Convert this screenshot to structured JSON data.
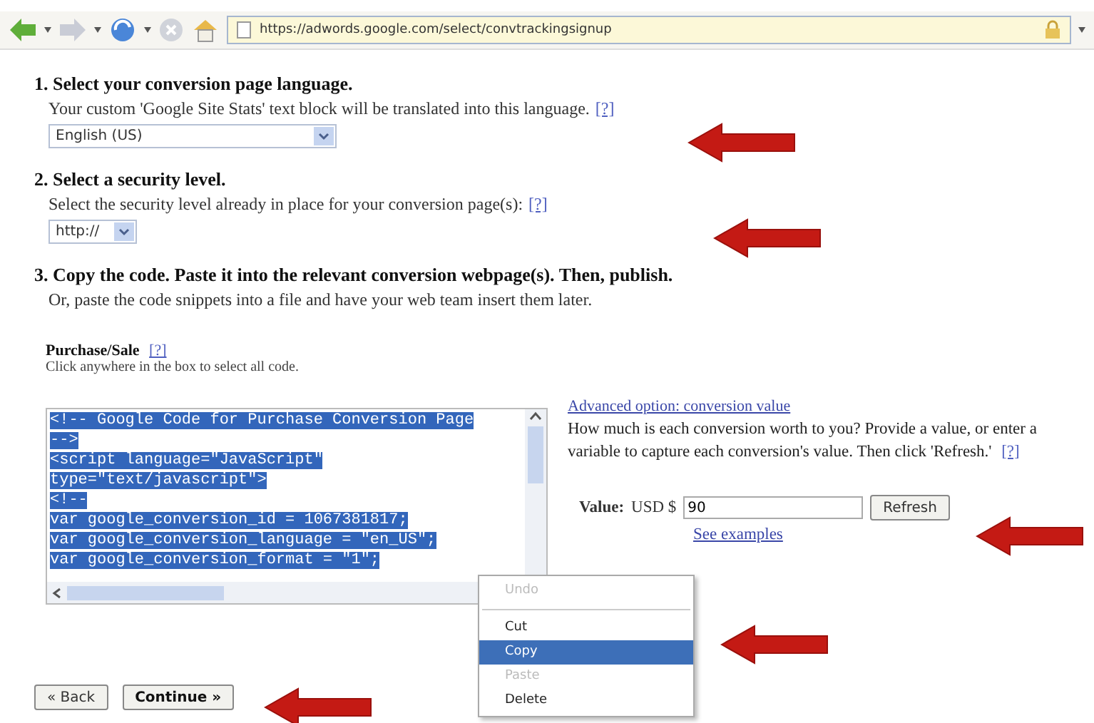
{
  "browser": {
    "url": "https://adwords.google.com/select/convtrackingsignup"
  },
  "steps": [
    {
      "number": "1.",
      "title": "Select your conversion page language.",
      "description": "Your custom 'Google Site Stats' text block will be translated into this language.",
      "help": "[?]",
      "select": {
        "value": "English (US)",
        "wide": true
      }
    },
    {
      "number": "2.",
      "title": "Select a security level.",
      "description": "Select the security level already in place for your conversion page(s):",
      "help": "[?]",
      "select": {
        "value": "http://",
        "wide": false
      }
    },
    {
      "number": "3.",
      "title": "Copy the code. Paste it into the relevant conversion webpage(s). Then, publish.",
      "description": "Or, paste the code snippets into a file and have your web team insert them later."
    }
  ],
  "snippet": {
    "title": "Purchase/Sale",
    "help": "[?]",
    "hint": "Click anywhere in the box to select all code.",
    "selected": true,
    "lines": [
      "<!-- Google Code for Purchase Conversion Page",
      "-->",
      "<script language=\"JavaScript\"",
      "type=\"text/javascript\">",
      "<!--",
      "var google_conversion_id = 1067381817;",
      "var google_conversion_language = \"en_US\";",
      "var google_conversion_format = \"1\";"
    ]
  },
  "advanced": {
    "link": "Advanced option: conversion value",
    "description": "How much is each conversion worth to you? Provide a value, or enter a variable to capture each conversion's value. Then click 'Refresh.'",
    "help": "[?]",
    "value_label": "Value:",
    "currency": "USD $",
    "value": "90",
    "refresh": "Refresh",
    "examples": "See examples"
  },
  "context_menu": [
    {
      "label": "Undo",
      "disabled": true,
      "selected": false
    },
    {
      "label": "Cut",
      "disabled": false,
      "selected": false
    },
    {
      "label": "Copy",
      "disabled": false,
      "selected": true
    },
    {
      "label": "Paste",
      "disabled": true,
      "selected": false
    },
    {
      "label": "Delete",
      "disabled": false,
      "selected": false
    }
  ],
  "buttons": [
    {
      "label": "« Back",
      "primary": false
    },
    {
      "label": "Continue »",
      "primary": true
    }
  ]
}
